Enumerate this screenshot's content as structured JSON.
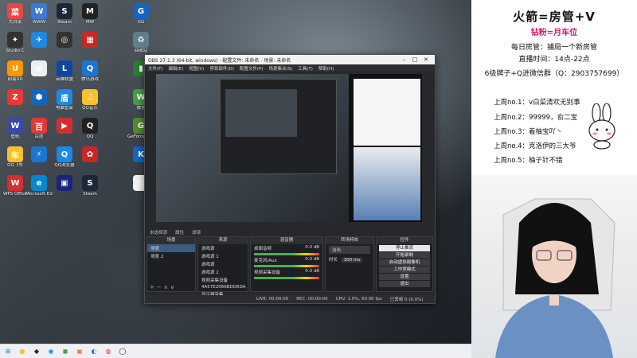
{
  "desktop_icons": [
    {
      "label": "大白菜",
      "color": "#e54848",
      "glyph": "菜"
    },
    {
      "label": "WWW",
      "color": "#3a7bd5",
      "glyph": "W"
    },
    {
      "label": "Steam",
      "color": "#1b2838",
      "glyph": "S"
    },
    {
      "label": "MW",
      "color": "#222",
      "glyph": "M"
    },
    {
      "label": "GG",
      "color": "#1565c0",
      "glyph": "G"
    },
    {
      "label": "Studio C",
      "color": "#333",
      "glyph": "✦"
    },
    {
      "label": "",
      "color": "#1e88e5",
      "glyph": "✈"
    },
    {
      "label": "",
      "color": "#333",
      "glyph": "◎"
    },
    {
      "label": "",
      "color": "#c62828",
      "glyph": "▦"
    },
    {
      "label": "回收站",
      "color": "#607d8b",
      "glyph": "♻"
    },
    {
      "label": "网易UU",
      "color": "#ff9800",
      "glyph": "U"
    },
    {
      "label": "",
      "color": "#eceff1",
      "glyph": "◍"
    },
    {
      "label": "英雄联盟",
      "color": "#0d47a1",
      "glyph": "L"
    },
    {
      "label": "腾讯游戏",
      "color": "#1976d2",
      "glyph": "Q"
    },
    {
      "label": "",
      "color": "#2e7d32",
      "glyph": "▮"
    },
    {
      "label": "",
      "color": "#e53935",
      "glyph": "Z"
    },
    {
      "label": "",
      "color": "#1565c0",
      "glyph": "⬢"
    },
    {
      "label": "电脑管家",
      "color": "#1e88e5",
      "glyph": "盾"
    },
    {
      "label": "QQ音乐",
      "color": "#fbc02d",
      "glyph": "♫"
    },
    {
      "label": "微信",
      "color": "#43a047",
      "glyph": "W"
    },
    {
      "label": "壁纸",
      "color": "#3949ab",
      "glyph": "W"
    },
    {
      "label": "百度",
      "color": "#e53935",
      "glyph": "百"
    },
    {
      "label": "",
      "color": "#d32f2f",
      "glyph": "▶"
    },
    {
      "label": "QQ",
      "color": "#212121",
      "glyph": "Q"
    },
    {
      "label": "GeForce Experience",
      "color": "#558b2f",
      "glyph": "G"
    },
    {
      "label": "QQ飞车",
      "color": "#fbc02d",
      "glyph": "车"
    },
    {
      "label": "",
      "color": "#1976d2",
      "glyph": "⚡"
    },
    {
      "label": "QQ浏览器",
      "color": "#1e88e5",
      "glyph": "Q"
    },
    {
      "label": "",
      "color": "#c62828",
      "glyph": "✿"
    },
    {
      "label": "",
      "color": "#1565c0",
      "glyph": "K"
    },
    {
      "label": "WPS Office",
      "color": "#d32f2f",
      "glyph": "W"
    },
    {
      "label": "Microsoft Edge",
      "color": "#0288d1",
      "glyph": "e"
    },
    {
      "label": "",
      "color": "#1a237e",
      "glyph": "▣"
    },
    {
      "label": "Steam",
      "color": "#1b2838",
      "glyph": "S"
    },
    {
      "label": "",
      "color": "#f5f5f5",
      "glyph": "▤"
    }
  ],
  "obs": {
    "title": "OBS 27.1.3 (64-bit, windows) - 配置文件: 未命名 - 场景: 未命名",
    "menu": [
      "文件(F)",
      "编辑(E)",
      "视图(V)",
      "停靠部件(D)",
      "配置文件(P)",
      "场景集合(S)",
      "工具(T)",
      "帮助(H)"
    ],
    "status_items": [
      "未选择源",
      "属性",
      "滤镜"
    ],
    "scenes_header": "场景",
    "scenes": [
      "场景",
      "场景 2"
    ],
    "sources_header": "来源",
    "sources": [
      "游戏源",
      "游戏源 1",
      "游戏源",
      "游戏源 2",
      "视频采集设备",
      "4A57E2066BDD6DA",
      "显示器采集"
    ],
    "mixer_header": "混音器",
    "mixer": [
      {
        "name": "桌面音频",
        "db": "0.0 dB"
      },
      {
        "name": "麦克风/Aux",
        "db": "0.0 dB"
      },
      {
        "name": "视频采集设备",
        "db": "0.0 dB"
      }
    ],
    "transitions_header": "转场特效",
    "transition_type": "淡出",
    "duration_label": "时长",
    "duration_value": "300 ms",
    "controls_header": "控件",
    "controls": [
      "停止推流",
      "开始录制",
      "启动虚拟摄像机",
      "工作室模式",
      "设置",
      "退出"
    ],
    "bottom": [
      "LIVE: 00:00:00",
      "REC: 00:00:00",
      "CPU: 1.0%, 60.00 fps",
      "已丢帧 0 (0.0%)"
    ]
  },
  "stream_panel": {
    "title": "火箭=房管+V",
    "subtitle": "钻粉=月车位",
    "lines": [
      "每日房管：捕局一个新房管",
      "直播时间：14点-22点",
      "6级牌子+Q进微信群（Q：2903757699）"
    ],
    "ranks": [
      "上周no.1：v白菜清欢无别事",
      "上周no.2：99999，俞二宝",
      "上周no.3：着柚宝吖丶",
      "上周no.4：克洛伊的三大爷",
      "上周no.5：柚子针不错"
    ]
  },
  "taskbar": [
    {
      "name": "windows-start-icon",
      "glyph": "⊞",
      "color": "#1e88e5"
    },
    {
      "name": "taskbar-app-1",
      "glyph": "●",
      "color": "#fbc02d"
    },
    {
      "name": "taskbar-app-2",
      "glyph": "◆",
      "color": "#222"
    },
    {
      "name": "taskbar-app-3",
      "glyph": "◉",
      "color": "#1e88e5"
    },
    {
      "name": "taskbar-app-4",
      "glyph": "◼",
      "color": "#43a047"
    },
    {
      "name": "taskbar-app-5",
      "glyph": "▣",
      "color": "#ff7043"
    },
    {
      "name": "taskbar-app-6",
      "glyph": "◐",
      "color": "#1976d2"
    },
    {
      "name": "taskbar-app-7",
      "glyph": "◍",
      "color": "#e53935"
    },
    {
      "name": "taskbar-app-8",
      "glyph": "◯",
      "color": "#212121"
    }
  ]
}
